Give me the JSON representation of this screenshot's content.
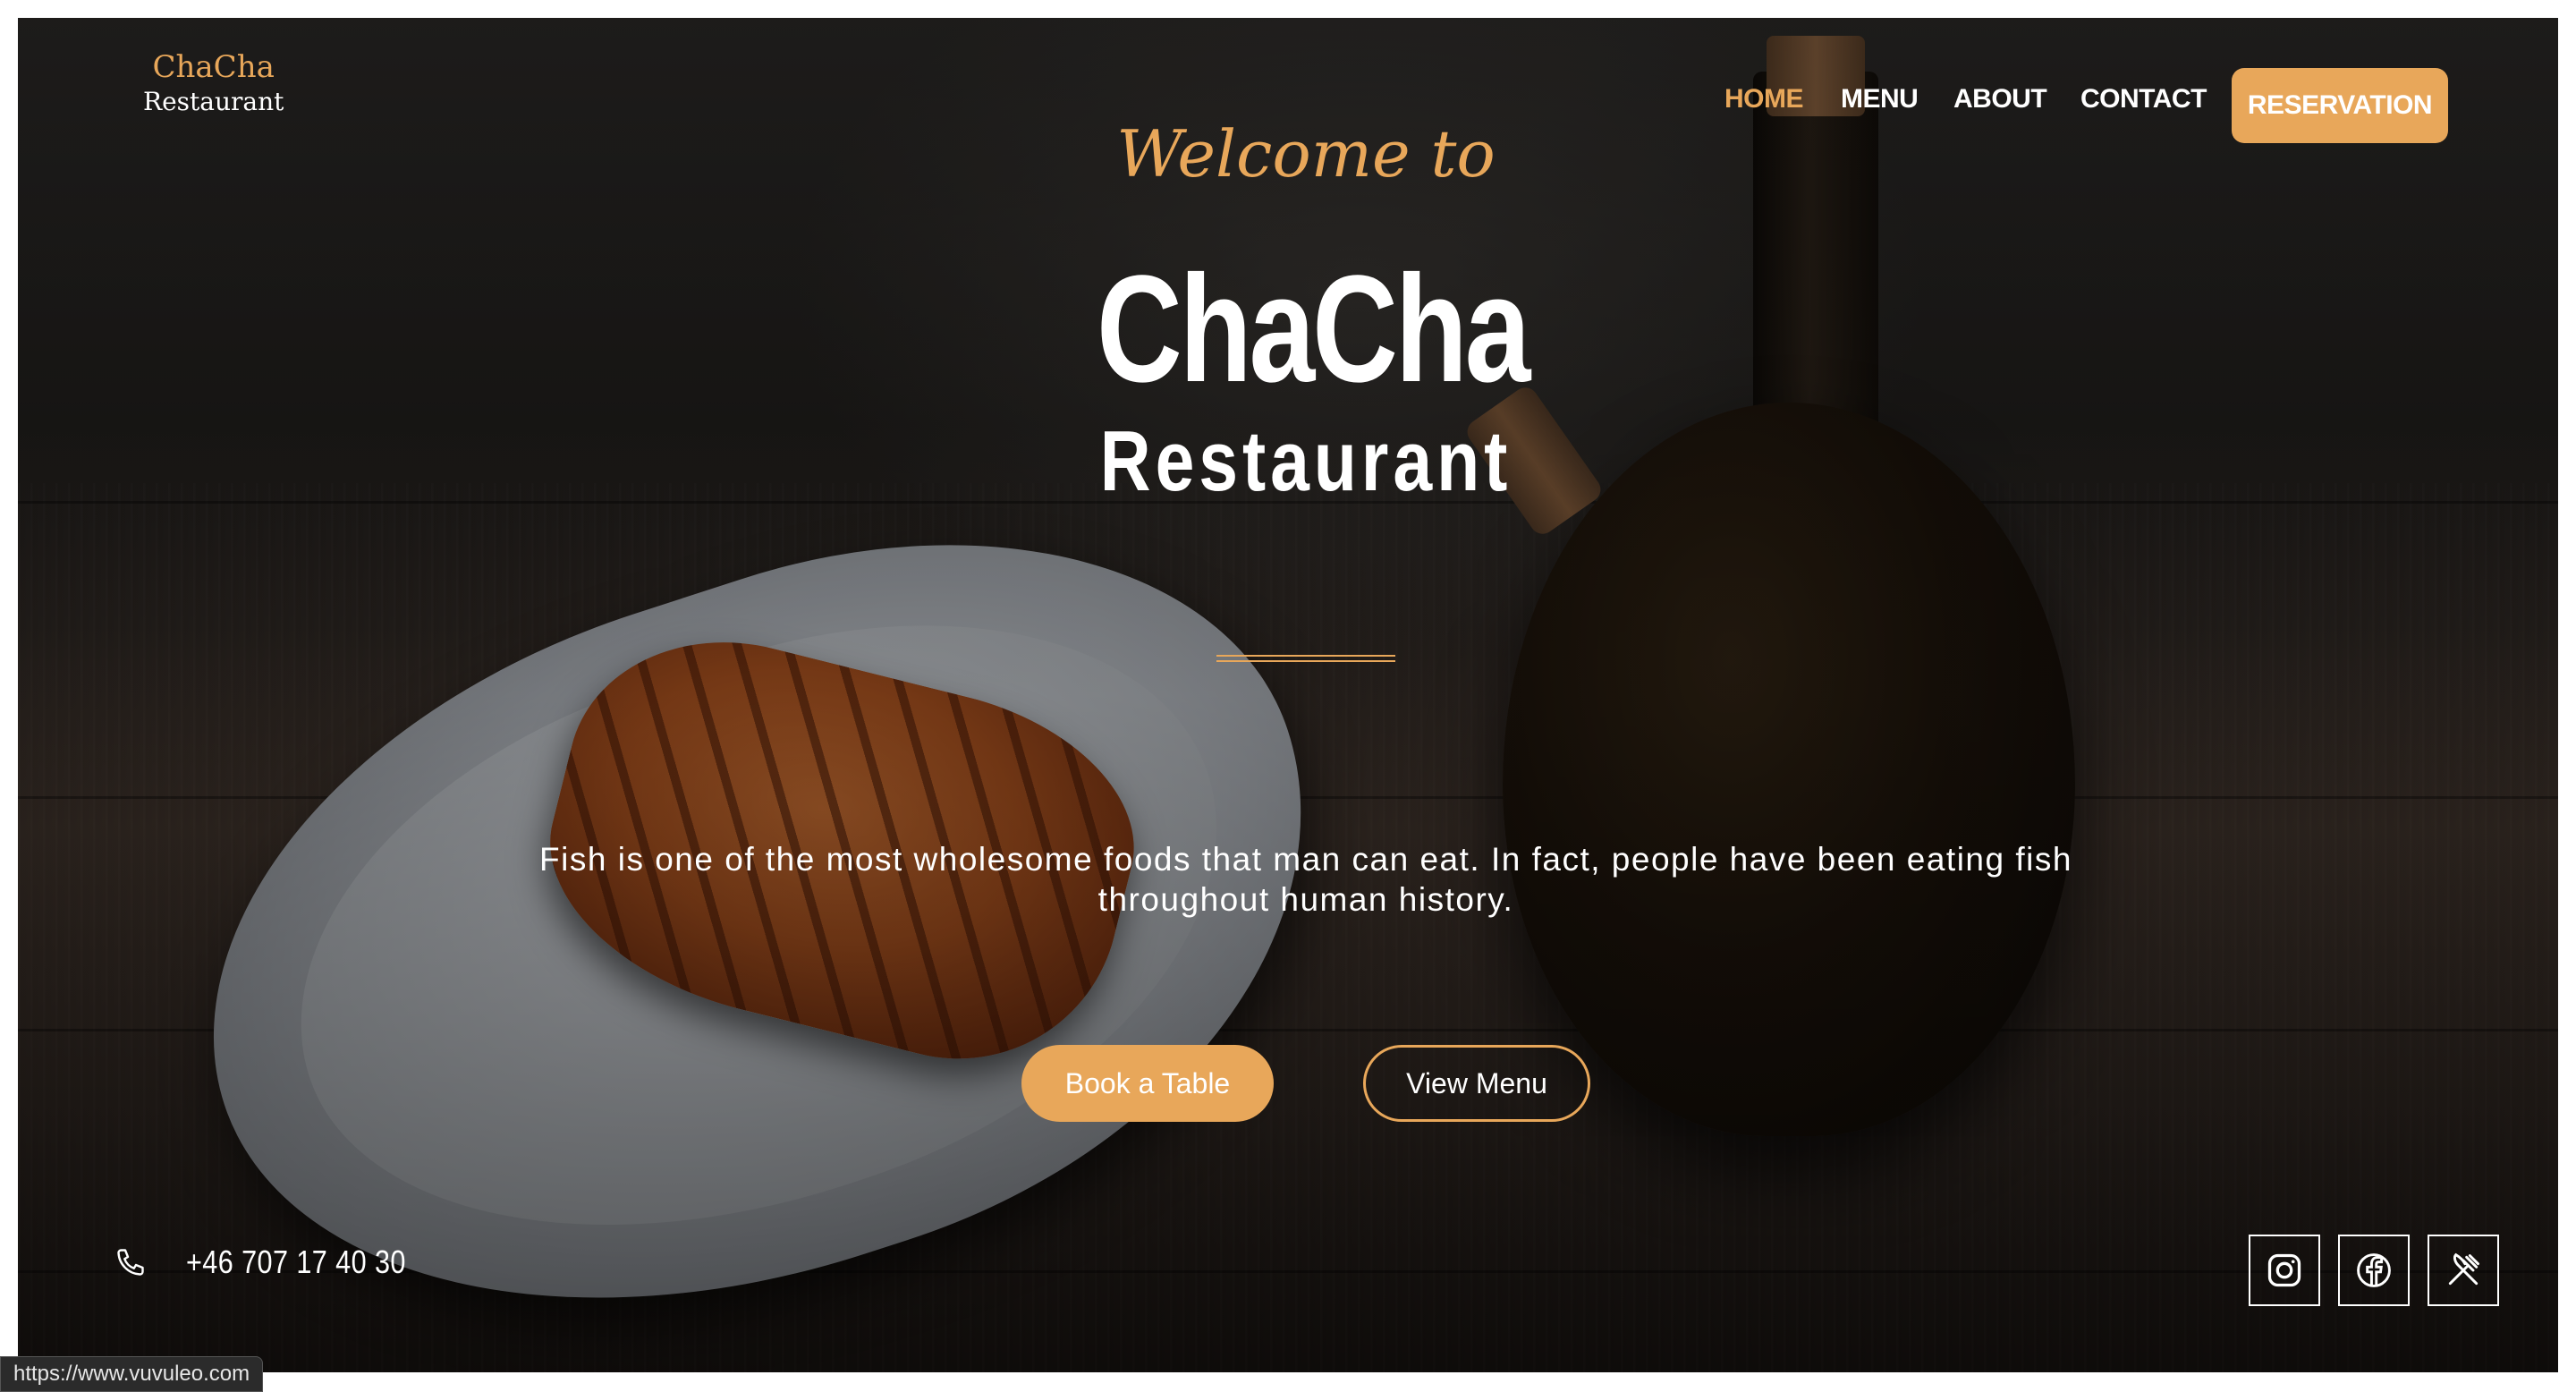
{
  "logo": {
    "line1": "ChaCha",
    "line2": "Restaurant"
  },
  "nav": {
    "items": [
      {
        "label": "HOME",
        "active": true
      },
      {
        "label": "MENU",
        "active": false
      },
      {
        "label": "ABOUT",
        "active": false
      },
      {
        "label": "CONTACT",
        "active": false
      }
    ],
    "reservation_label": "RESERVATION"
  },
  "hero": {
    "welcome": "Welcome to",
    "title_line1": "ChaCha",
    "title_line2": "Restaurant",
    "tagline": "Fish is one of the most wholesome foods that man can eat. In fact, people have been eating fish throughout human history.",
    "book_button": "Book a Table",
    "menu_button": "View Menu"
  },
  "contact": {
    "phone": "+46 707 17 40 30"
  },
  "social": {
    "icons": [
      "instagram-icon",
      "facebook-icon",
      "fork-knife-icon"
    ]
  },
  "status_bar": {
    "url": "https://www.vuvuleo.com"
  },
  "colors": {
    "accent": "#e8a75a",
    "text": "#ffffff"
  }
}
